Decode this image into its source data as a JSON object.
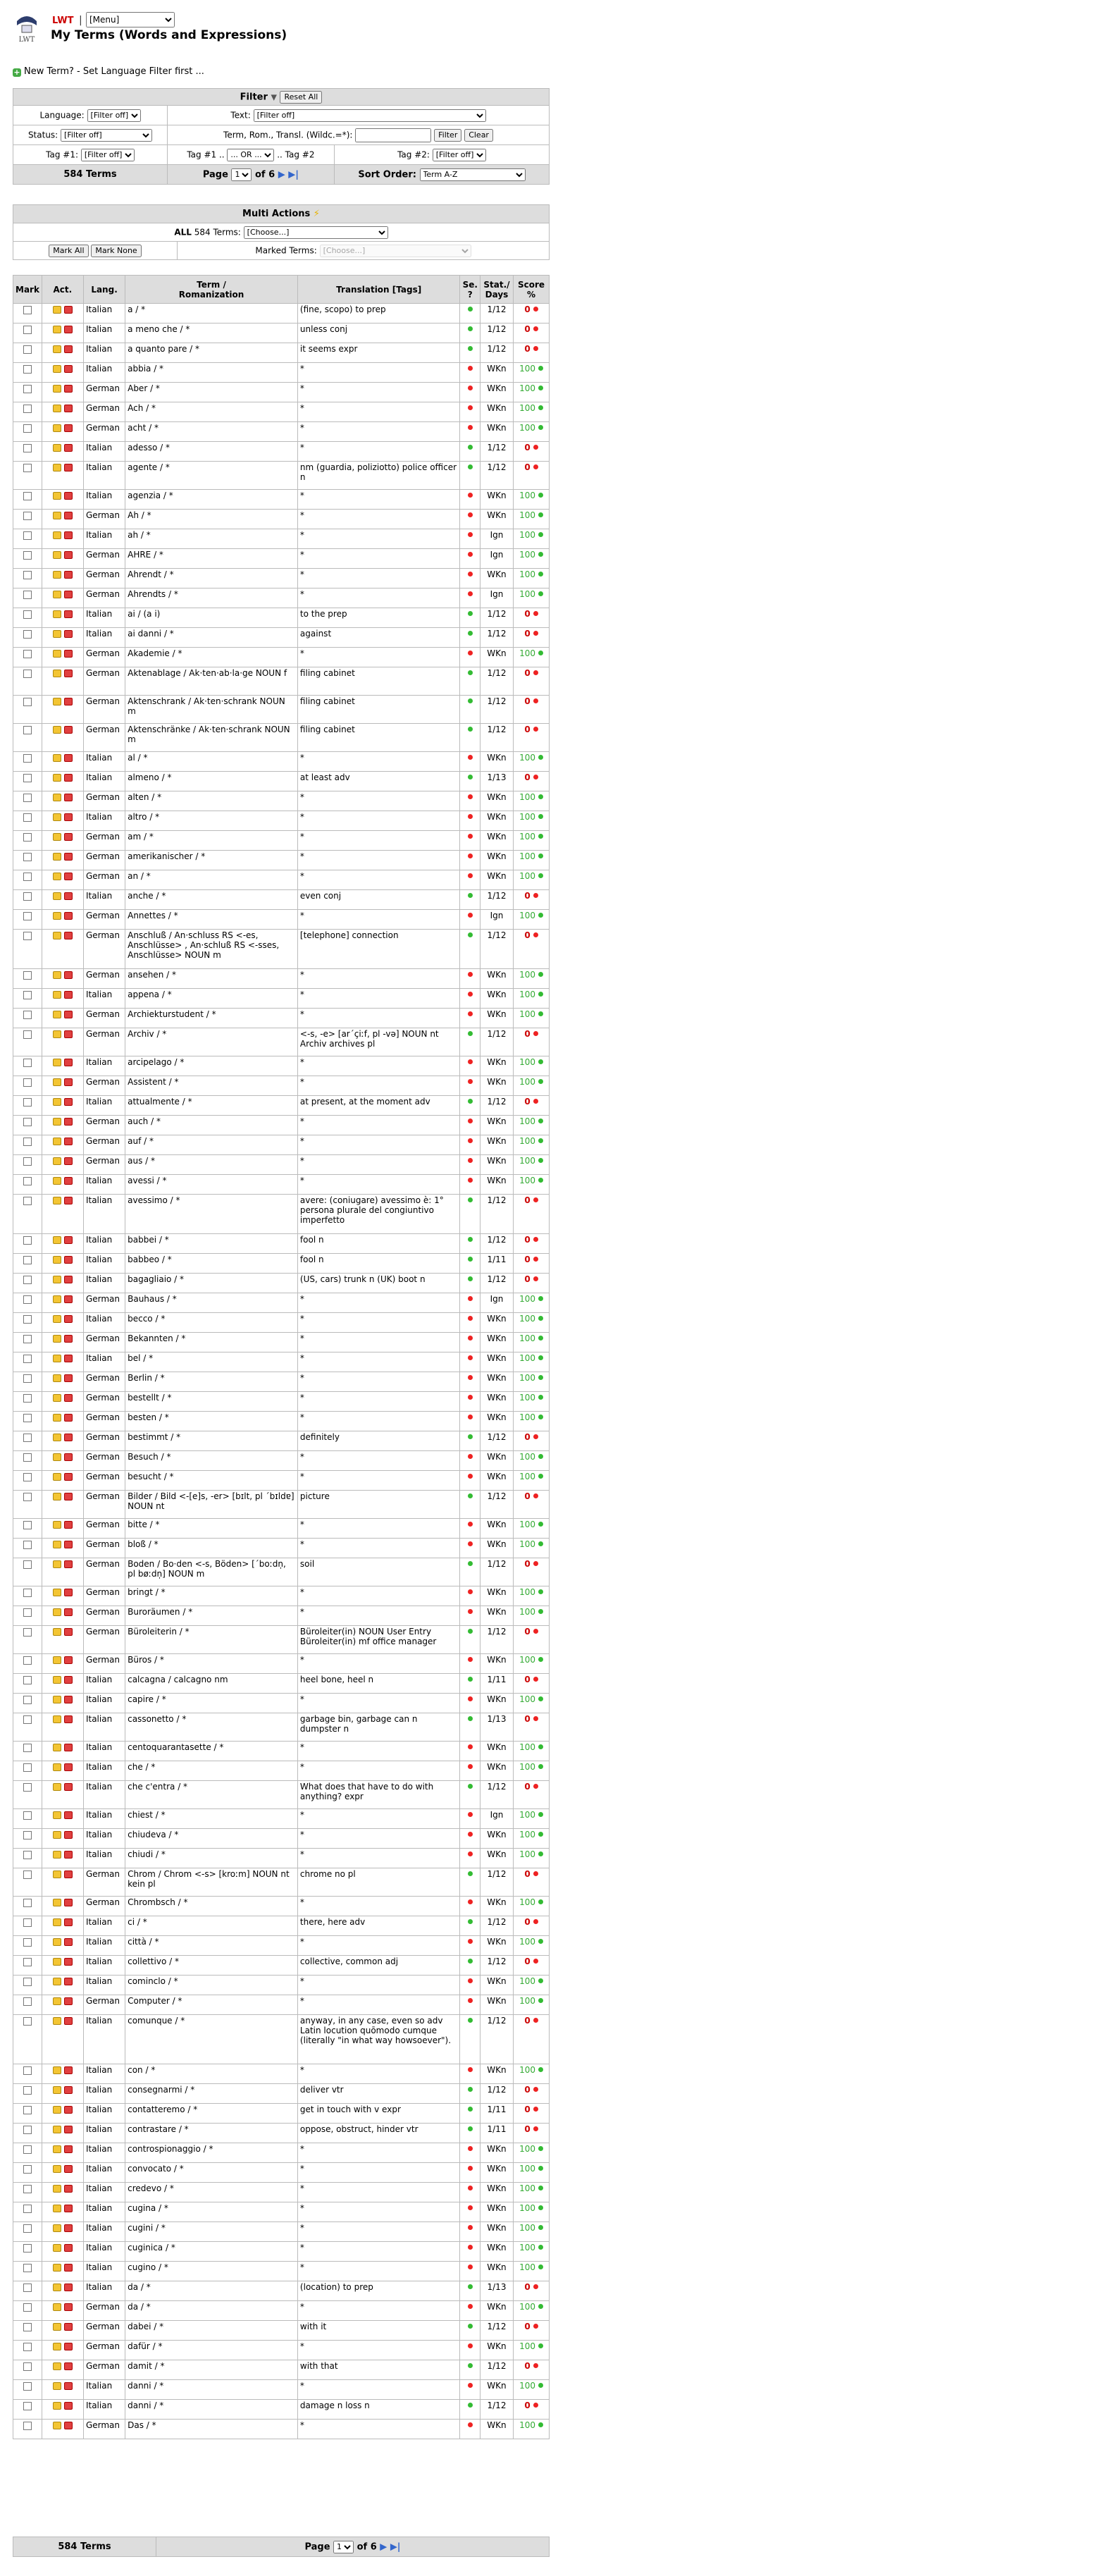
{
  "header": {
    "logo_text": "LWT",
    "separator": "|",
    "menu_selected": "[Menu]",
    "title": "My Terms (Words and Expressions)"
  },
  "new_term": {
    "icon": "plus-icon",
    "text": "New Term? - Set Language Filter first ..."
  },
  "filter": {
    "title": "Filter",
    "reset_label": "Reset All",
    "language_label": "Language:",
    "language_value": "[Filter off]",
    "text_label": "Text:",
    "text_value": "[Filter off]",
    "status_label": "Status:",
    "status_value": "[Filter off]",
    "term_label": "Term, Rom., Transl. (Wildc.=*):",
    "term_value": "",
    "filter_btn": "Filter",
    "clear_btn": "Clear",
    "tag1_label": "Tag #1:",
    "tag1_value": "[Filter off]",
    "tag12_label": "Tag #1 .. ",
    "tag12_op": "... OR ...",
    "tag12_label2": " .. Tag #2",
    "tag2_label": "Tag #2:",
    "tag2_value": "[Filter off]",
    "count": "584 Terms",
    "page_label": "Page",
    "page_value": "1",
    "of_label": "of 6",
    "sort_label": "Sort Order:",
    "sort_value": "Term A-Z"
  },
  "multi": {
    "title": "Multi Actions",
    "all_label": "ALL",
    "all_count": "584 Terms:",
    "all_choose": "[Choose...]",
    "mark_all": "Mark All",
    "mark_none": "Mark None",
    "marked_label": "Marked Terms:",
    "marked_choose": "[Choose...]"
  },
  "table": {
    "headers": [
      "Mark",
      "Act.",
      "Lang.",
      "Term /",
      "Romanization",
      "Translation [Tags]",
      "Se.",
      "?",
      "Stat./",
      "Days",
      "Score",
      "%"
    ]
  },
  "rows": [
    [
      "Italian",
      "a / *",
      "(fine, scopo) to prep",
      "g",
      "1/12",
      "0",
      "r"
    ],
    [
      "Italian",
      "a meno che / *",
      "unless conj",
      "g",
      "1/12",
      "0",
      "r"
    ],
    [
      "Italian",
      "a quanto pare / *",
      "it seems expr",
      "g",
      "1/12",
      "0",
      "r"
    ],
    [
      "Italian",
      "abbia / *",
      "*",
      "r",
      "WKn",
      "100",
      "g"
    ],
    [
      "German",
      "Aber / *",
      "*",
      "r",
      "WKn",
      "100",
      "g"
    ],
    [
      "German",
      "Ach / *",
      "*",
      "r",
      "WKn",
      "100",
      "g"
    ],
    [
      "German",
      "acht / *",
      "*",
      "r",
      "WKn",
      "100",
      "g"
    ],
    [
      "Italian",
      "adesso / *",
      "*",
      "g",
      "1/12",
      "0",
      "r"
    ],
    [
      "Italian",
      "agente / *",
      "nm (guardia, poliziotto) police officer n",
      "g",
      "1/12",
      "0",
      "r"
    ],
    [
      "Italian",
      "agenzia / *",
      "*",
      "r",
      "WKn",
      "100",
      "g"
    ],
    [
      "German",
      "Ah / *",
      "*",
      "r",
      "WKn",
      "100",
      "g"
    ],
    [
      "Italian",
      "ah / *",
      "*",
      "r",
      "Ign",
      "100",
      "g"
    ],
    [
      "German",
      "AHRE / *",
      "*",
      "r",
      "Ign",
      "100",
      "g"
    ],
    [
      "German",
      "Ahrendt / *",
      "*",
      "r",
      "WKn",
      "100",
      "g"
    ],
    [
      "German",
      "Ahrendts / *",
      "*",
      "r",
      "Ign",
      "100",
      "g"
    ],
    [
      "Italian",
      "ai / (a i)",
      "to the prep",
      "g",
      "1/12",
      "0",
      "r"
    ],
    [
      "Italian",
      "ai danni / *",
      "against",
      "g",
      "1/12",
      "0",
      "r"
    ],
    [
      "German",
      "Akademie / *",
      "*",
      "r",
      "WKn",
      "100",
      "g"
    ],
    [
      "German",
      "Aktenablage / Ak·ten·ab·la·ge NOUN f",
      "filing cabinet",
      "g",
      "1/12",
      "0",
      "r"
    ],
    [
      "German",
      "Aktenschrank / Ak·ten·schrank NOUN m",
      "filing cabinet",
      "g",
      "1/12",
      "0",
      "r"
    ],
    [
      "German",
      "Aktenschränke / Ak·ten·schrank NOUN m",
      "filing cabinet",
      "g",
      "1/12",
      "0",
      "r"
    ],
    [
      "Italian",
      "al / *",
      "*",
      "r",
      "WKn",
      "100",
      "g"
    ],
    [
      "Italian",
      "almeno / *",
      "at least adv",
      "g",
      "1/13",
      "0",
      "r"
    ],
    [
      "German",
      "alten / *",
      "*",
      "r",
      "WKn",
      "100",
      "g"
    ],
    [
      "Italian",
      "altro / *",
      "*",
      "r",
      "WKn",
      "100",
      "g"
    ],
    [
      "German",
      "am / *",
      "*",
      "r",
      "WKn",
      "100",
      "g"
    ],
    [
      "German",
      "amerikanischer / *",
      "*",
      "r",
      "WKn",
      "100",
      "g"
    ],
    [
      "German",
      "an / *",
      "*",
      "r",
      "WKn",
      "100",
      "g"
    ],
    [
      "Italian",
      "anche / *",
      "even conj",
      "g",
      "1/12",
      "0",
      "r"
    ],
    [
      "German",
      "Annettes / *",
      "*",
      "r",
      "Ign",
      "100",
      "g"
    ],
    [
      "German",
      "Anschluß / An·schluss RS <-es, Anschlüsse> , An·schluß RS <-sses, Anschlüsse> NOUN m",
      "[telephone] connection",
      "g",
      "1/12",
      "0",
      "r"
    ],
    [
      "German",
      "ansehen / *",
      "*",
      "r",
      "WKn",
      "100",
      "g"
    ],
    [
      "Italian",
      "appena / *",
      "*",
      "r",
      "WKn",
      "100",
      "g"
    ],
    [
      "German",
      "Archiekturstudent / *",
      "*",
      "r",
      "WKn",
      "100",
      "g"
    ],
    [
      "German",
      "Archiv / *",
      "<-s, -e> [ar´çiːf, pl -vǝ] NOUN nt Archiv archives pl",
      "g",
      "1/12",
      "0",
      "r"
    ],
    [
      "Italian",
      "arcipelago / *",
      "*",
      "r",
      "WKn",
      "100",
      "g"
    ],
    [
      "German",
      "Assistent / *",
      "*",
      "r",
      "WKn",
      "100",
      "g"
    ],
    [
      "Italian",
      "attualmente / *",
      "at present, at the moment adv",
      "g",
      "1/12",
      "0",
      "r"
    ],
    [
      "German",
      "auch / *",
      "*",
      "r",
      "WKn",
      "100",
      "g"
    ],
    [
      "German",
      "auf / *",
      "*",
      "r",
      "WKn",
      "100",
      "g"
    ],
    [
      "German",
      "aus / *",
      "*",
      "r",
      "WKn",
      "100",
      "g"
    ],
    [
      "Italian",
      "avessi / *",
      "*",
      "r",
      "WKn",
      "100",
      "g"
    ],
    [
      "Italian",
      "avessimo / *",
      "avere: (coniugare) avessimo è: 1° persona plurale del congiuntivo imperfetto",
      "g",
      "1/12",
      "0",
      "r"
    ],
    [
      "Italian",
      "babbei / *",
      "fool n",
      "g",
      "1/12",
      "0",
      "r"
    ],
    [
      "Italian",
      "babbeo / *",
      "fool n",
      "g",
      "1/11",
      "0",
      "r"
    ],
    [
      "Italian",
      "bagagliaio / *",
      "(US, cars) trunk n (UK) boot n",
      "g",
      "1/12",
      "0",
      "r"
    ],
    [
      "German",
      "Bauhaus / *",
      "*",
      "r",
      "Ign",
      "100",
      "g"
    ],
    [
      "Italian",
      "becco / *",
      "*",
      "r",
      "WKn",
      "100",
      "g"
    ],
    [
      "German",
      "Bekannten / *",
      "*",
      "r",
      "WKn",
      "100",
      "g"
    ],
    [
      "Italian",
      "bel / *",
      "*",
      "r",
      "WKn",
      "100",
      "g"
    ],
    [
      "German",
      "Berlin / *",
      "*",
      "r",
      "WKn",
      "100",
      "g"
    ],
    [
      "German",
      "bestellt / *",
      "*",
      "r",
      "WKn",
      "100",
      "g"
    ],
    [
      "German",
      "besten / *",
      "*",
      "r",
      "WKn",
      "100",
      "g"
    ],
    [
      "German",
      "bestimmt / *",
      "definitely",
      "g",
      "1/12",
      "0",
      "r"
    ],
    [
      "German",
      "Besuch / *",
      "*",
      "r",
      "WKn",
      "100",
      "g"
    ],
    [
      "German",
      "besucht / *",
      "*",
      "r",
      "WKn",
      "100",
      "g"
    ],
    [
      "German",
      "Bilder / Bild <-[e]s, -er> [bɪlt, pl ´bɪldɐ] NOUN nt",
      "picture",
      "g",
      "1/12",
      "0",
      "r"
    ],
    [
      "German",
      "bitte / *",
      "*",
      "r",
      "WKn",
      "100",
      "g"
    ],
    [
      "German",
      "bloß / *",
      "*",
      "r",
      "WKn",
      "100",
      "g"
    ],
    [
      "German",
      "Boden / Bo·den <-s, Böden> [´boːdn̩, pl bøːdn̩] NOUN m",
      "soil",
      "g",
      "1/12",
      "0",
      "r"
    ],
    [
      "German",
      "bringt / *",
      "*",
      "r",
      "WKn",
      "100",
      "g"
    ],
    [
      "German",
      "Buroräumen / *",
      "*",
      "r",
      "WKn",
      "100",
      "g"
    ],
    [
      "German",
      "Büroleiterin / *",
      "Büroleiter(in) NOUN User Entry Büroleiter(in) mf office manager",
      "g",
      "1/12",
      "0",
      "r"
    ],
    [
      "German",
      "Büros / *",
      "*",
      "r",
      "WKn",
      "100",
      "g"
    ],
    [
      "Italian",
      "calcagna / calcagno nm",
      "heel bone, heel n",
      "g",
      "1/11",
      "0",
      "r"
    ],
    [
      "Italian",
      "capire / *",
      "*",
      "r",
      "WKn",
      "100",
      "g"
    ],
    [
      "Italian",
      "cassonetto / *",
      "garbage bin, garbage can n dumpster n",
      "g",
      "1/13",
      "0",
      "r"
    ],
    [
      "Italian",
      "centoquarantasette / *",
      "*",
      "r",
      "WKn",
      "100",
      "g"
    ],
    [
      "Italian",
      "che / *",
      "*",
      "r",
      "WKn",
      "100",
      "g"
    ],
    [
      "Italian",
      "che c'entra / *",
      "What does that have to do with anything? expr",
      "g",
      "1/12",
      "0",
      "r"
    ],
    [
      "Italian",
      "chiest / *",
      "*",
      "r",
      "Ign",
      "100",
      "g"
    ],
    [
      "Italian",
      "chiudeva / *",
      "*",
      "r",
      "WKn",
      "100",
      "g"
    ],
    [
      "Italian",
      "chiudi / *",
      "*",
      "r",
      "WKn",
      "100",
      "g"
    ],
    [
      "German",
      "Chrom / Chrom <-s> [kroːm] NOUN nt kein pl",
      "chrome no pl",
      "g",
      "1/12",
      "0",
      "r"
    ],
    [
      "German",
      "Chrombsch / *",
      "*",
      "r",
      "WKn",
      "100",
      "g"
    ],
    [
      "Italian",
      "ci / *",
      "there, here adv",
      "g",
      "1/12",
      "0",
      "r"
    ],
    [
      "Italian",
      "città / *",
      "*",
      "r",
      "WKn",
      "100",
      "g"
    ],
    [
      "Italian",
      "collettivo / *",
      "collective, common adj",
      "g",
      "1/12",
      "0",
      "r"
    ],
    [
      "Italian",
      "cominclo / *",
      "*",
      "r",
      "WKn",
      "100",
      "g"
    ],
    [
      "German",
      "Computer / *",
      "*",
      "r",
      "WKn",
      "100",
      "g"
    ],
    [
      "Italian",
      "comunque / *",
      "anyway, in any case, even so adv Latin locution quōmodo cumque (literally \"in what way howsoever\").",
      "g",
      "1/12",
      "0",
      "r"
    ],
    [
      "Italian",
      "con / *",
      "*",
      "r",
      "WKn",
      "100",
      "g"
    ],
    [
      "Italian",
      "consegnarmi / *",
      "deliver vtr",
      "g",
      "1/12",
      "0",
      "r"
    ],
    [
      "Italian",
      "contatteremo / *",
      "get in touch with v expr",
      "g",
      "1/11",
      "0",
      "r"
    ],
    [
      "Italian",
      "contrastare / *",
      "oppose, obstruct, hinder vtr",
      "g",
      "1/11",
      "0",
      "r"
    ],
    [
      "Italian",
      "controspionaggio / *",
      "*",
      "r",
      "WKn",
      "100",
      "g"
    ],
    [
      "Italian",
      "convocato / *",
      "*",
      "r",
      "WKn",
      "100",
      "g"
    ],
    [
      "Italian",
      "credevo / *",
      "*",
      "r",
      "WKn",
      "100",
      "g"
    ],
    [
      "Italian",
      "cugina / *",
      "*",
      "r",
      "WKn",
      "100",
      "g"
    ],
    [
      "Italian",
      "cugini / *",
      "*",
      "r",
      "WKn",
      "100",
      "g"
    ],
    [
      "Italian",
      "cuginica / *",
      "*",
      "r",
      "WKn",
      "100",
      "g"
    ],
    [
      "Italian",
      "cugino / *",
      "*",
      "r",
      "WKn",
      "100",
      "g"
    ],
    [
      "Italian",
      "da / *",
      "(location) to prep",
      "g",
      "1/13",
      "0",
      "r"
    ],
    [
      "German",
      "da / *",
      "*",
      "r",
      "WKn",
      "100",
      "g"
    ],
    [
      "German",
      "dabei / *",
      "with it",
      "g",
      "1/12",
      "0",
      "r"
    ],
    [
      "German",
      "dafür / *",
      "*",
      "r",
      "WKn",
      "100",
      "g"
    ],
    [
      "German",
      "damit / *",
      "with that",
      "g",
      "1/12",
      "0",
      "r"
    ],
    [
      "Italian",
      "danni / *",
      "*",
      "r",
      "WKn",
      "100",
      "g"
    ],
    [
      "Italian",
      "danni / *",
      "damage n loss n",
      "g",
      "1/12",
      "0",
      "r"
    ],
    [
      "German",
      "Das / *",
      "*",
      "r",
      "WKn",
      "100",
      "g"
    ]
  ],
  "footer": {
    "count": "584 Terms",
    "page_label": "Page",
    "page_value": "1",
    "of_label": "of 6"
  }
}
